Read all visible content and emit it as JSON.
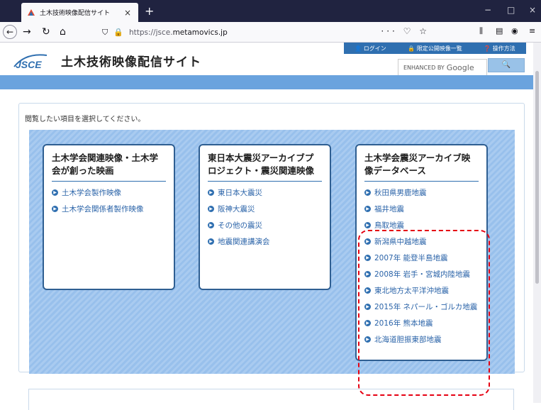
{
  "browser": {
    "tab_title": "土木技術映像配信サイト",
    "tab_close": "×",
    "new_tab": "+",
    "url_prefix": "https://jsce.",
    "url_domain": "metamovics.jp",
    "win_minimize": "−",
    "win_maximize": "□",
    "win_close": "×"
  },
  "header": {
    "logo_text": "JSCE",
    "site_title": "土木技術映像配信サイト",
    "top_links": [
      "ログイン",
      "限定公開映像一覧",
      "操作方法"
    ],
    "search_brand_prefix": "ENHANCED BY",
    "search_brand": "Google",
    "search_button": "🔍"
  },
  "main": {
    "instruction": "閲覧したい項目を選択してください。",
    "cards": [
      {
        "title": "土木学会関連映像・土木学会が創った映画",
        "items": [
          "土木学会製作映像",
          "土木学会関係者製作映像"
        ]
      },
      {
        "title": "東日本大震災アーカイブプロジェクト・震災関連映像",
        "items": [
          "東日本大震災",
          "阪神大震災",
          "その他の震災",
          "地震関連講演会"
        ]
      },
      {
        "title": "土木学会震災アーカイブ映像データベース",
        "items": [
          "秋田県男鹿地震",
          "福井地震",
          "鳥取地震",
          "新潟県中越地震",
          "2007年 能登半島地震",
          "2008年 岩手・宮城内陸地震",
          "東北地方太平洋沖地震",
          "2015年 ネパール・ゴルカ地震",
          "2016年 熊本地震",
          "北海道胆振東部地震"
        ]
      }
    ]
  },
  "colors": {
    "accent": "#2f6fb0",
    "highlight": "#e50012",
    "titlebar": "#202340"
  }
}
